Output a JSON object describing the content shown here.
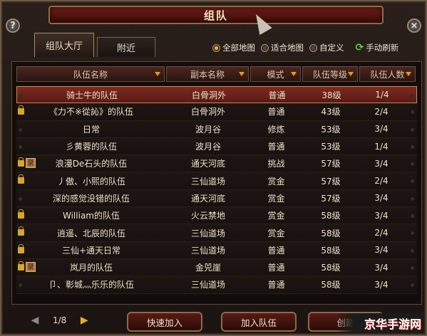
{
  "window": {
    "title": "组队",
    "help_label": "?",
    "close_label": "×"
  },
  "tabs": [
    {
      "label": "组队大厅",
      "active": true
    },
    {
      "label": "附近",
      "active": false
    }
  ],
  "filters": {
    "options": [
      {
        "label": "全部地图",
        "checked": true
      },
      {
        "label": "适合地图",
        "checked": false
      },
      {
        "label": "自定义",
        "checked": false
      }
    ],
    "refresh_label": "手动刷新"
  },
  "table": {
    "columns": [
      "队伍名称",
      "副本名称",
      "模式",
      "队伍等级",
      "队伍人数"
    ],
    "rows": [
      {
        "name": "骑士牛的队伍",
        "map": "白骨洞外",
        "mode": "普通",
        "level": "38级",
        "count": "1/4",
        "locked": false,
        "badge": "",
        "selected": true
      },
      {
        "name": "《力不※從訫》的队伍",
        "map": "白骨洞外",
        "mode": "普通",
        "level": "43级",
        "count": "2/4",
        "locked": true,
        "badge": "",
        "selected": false
      },
      {
        "name": "日常",
        "map": "波月谷",
        "mode": "修炼",
        "level": "53级",
        "count": "3/4",
        "locked": false,
        "badge": "",
        "selected": false
      },
      {
        "name": "彡黄蓉的队伍",
        "map": "波月谷",
        "mode": "普通",
        "level": "53级",
        "count": "1/4",
        "locked": false,
        "badge": "",
        "selected": false
      },
      {
        "name": "浪漫De石头的队伍",
        "map": "通天河底",
        "mode": "挑战",
        "level": "57级",
        "count": "3/4",
        "locked": true,
        "badge": "录",
        "selected": false
      },
      {
        "name": "丿傲、小熙的队伍",
        "map": "三仙道场",
        "mode": "赏金",
        "level": "57级",
        "count": "2/4",
        "locked": true,
        "badge": "",
        "selected": false
      },
      {
        "name": "深的感觉没错的队伍",
        "map": "通天河底",
        "mode": "赏金",
        "level": "57级",
        "count": "3/4",
        "locked": false,
        "badge": "",
        "selected": false
      },
      {
        "name": "William的队伍",
        "map": "火云禁地",
        "mode": "赏金",
        "level": "58级",
        "count": "3/4",
        "locked": true,
        "badge": "",
        "selected": false
      },
      {
        "name": "逍遥、北辰的队伍",
        "map": "三仙道场",
        "mode": "赏金",
        "level": "58级",
        "count": "2/4",
        "locked": true,
        "badge": "",
        "selected": false
      },
      {
        "name": "三仙+通天日常",
        "map": "三仙道场",
        "mode": "普通",
        "level": "58级",
        "count": "3/4",
        "locked": true,
        "badge": "",
        "selected": false
      },
      {
        "name": "岚月的队伍",
        "map": "金兕崖",
        "mode": "普通",
        "level": "58级",
        "count": "3/4",
        "locked": true,
        "badge": "录",
        "selected": false
      },
      {
        "name": "卩、彰城灬乐乐的队伍",
        "map": "三仙道场",
        "mode": "普通",
        "level": "58级",
        "count": "3/4",
        "locked": false,
        "badge": "",
        "selected": false
      }
    ]
  },
  "pager": {
    "text": "1/8"
  },
  "buttons": {
    "quick_join": "快速加入",
    "join_team": "加入队伍",
    "create": "创建"
  },
  "watermark": "京华手游网"
}
